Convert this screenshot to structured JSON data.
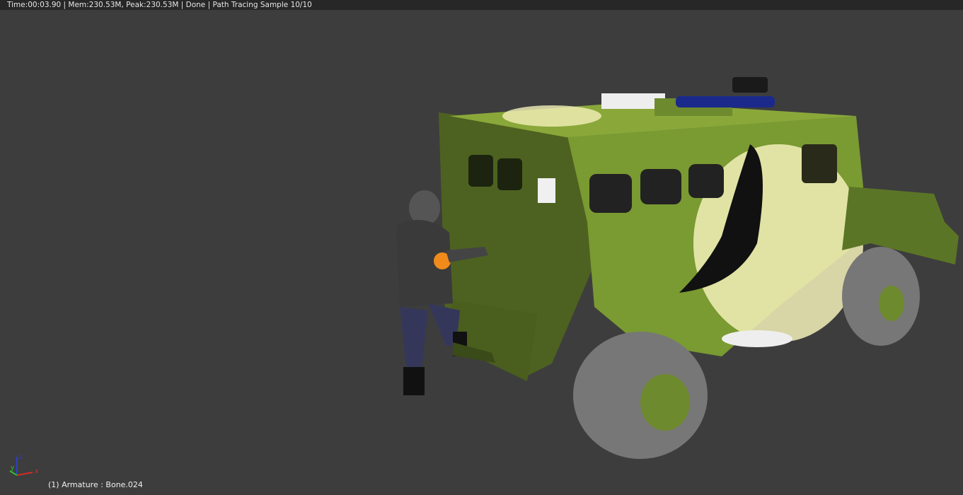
{
  "status_bar": {
    "text": "Time:00:03.90 | Mem:230.53M, Peak:230.53M | Done | Path Tracing Sample 10/10"
  },
  "viewport": {
    "object_info": "(1) Armature : Bone.024",
    "axes": {
      "x": "x",
      "y": "y",
      "z": "z",
      "x_color": "#d42a2a",
      "y_color": "#2fbf2f",
      "z_color": "#2a3fd4"
    }
  },
  "colors": {
    "background": "#3d3d3d",
    "vehicle": "#6e8a2e",
    "highlight": "#f3f0b8"
  }
}
